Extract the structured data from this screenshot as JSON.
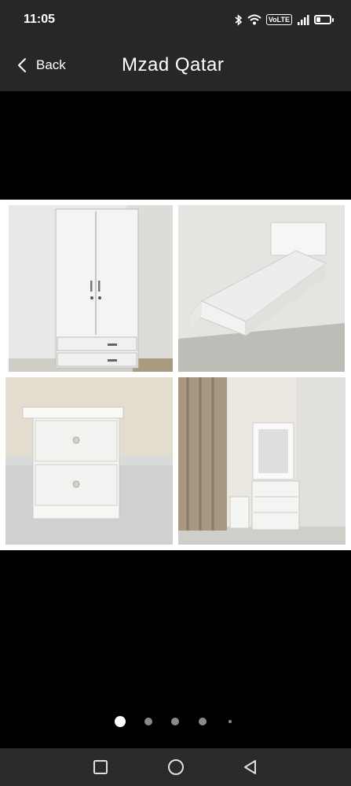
{
  "status_bar": {
    "time": "11:05",
    "volte_label": "VoLTE",
    "battery_level": 0.3,
    "icons": [
      "bluetooth-icon",
      "wifi-icon",
      "volte-icon",
      "signal-icon",
      "battery-icon"
    ]
  },
  "app_bar": {
    "back_label": "Back",
    "title": "Mzad Qatar"
  },
  "gallery": {
    "current_page": 1,
    "page_count": 5,
    "photos": [
      "wardrobe",
      "single-bed",
      "nightstand",
      "dresser-with-mirror"
    ]
  },
  "nav_bar": {
    "buttons": [
      "recents-square-icon",
      "home-circle-icon",
      "back-triangle-icon"
    ]
  },
  "colors": {
    "bar_background": "#272727",
    "screen_background": "#000000",
    "active_dot": "#ffffff",
    "inactive_dot": "#8a8a8a"
  }
}
